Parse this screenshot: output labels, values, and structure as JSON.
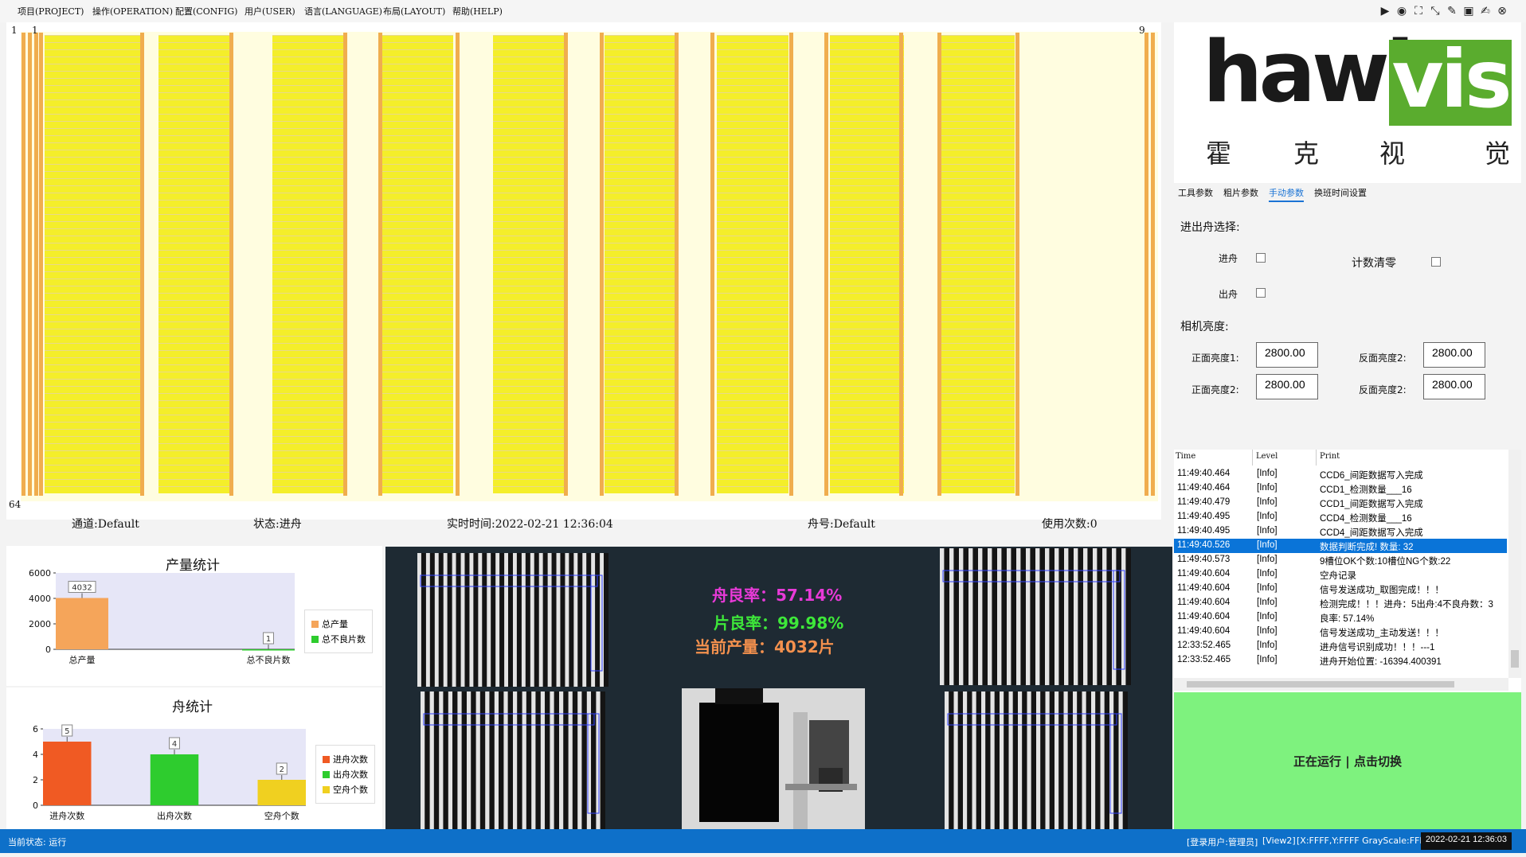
{
  "menu": [
    "项目(PROJECT)",
    "操作(OPERATION)",
    "配置(CONFIG)",
    "用户(USER)",
    "语言(LANGUAGE)",
    "布局(LAYOUT)",
    "帮助(HELP)"
  ],
  "tray": {
    "corner_tl_row": "1",
    "corner_tl_col": "1",
    "corner_tr": "9",
    "corner_bl": "64"
  },
  "info": {
    "channel": "通道:Default",
    "state": "状态:进舟",
    "realtime": "实时时间:2022-02-21 12:36:04",
    "boat": "舟号:Default",
    "uses": "使用次数:0"
  },
  "production_chart": {
    "title": "产量统计",
    "legend": [
      "总产量",
      "总不良片数"
    ],
    "colors": [
      "#f5a55a",
      "#2ecc2e"
    ]
  },
  "boat_chart": {
    "title": "舟统计",
    "legend": [
      "进舟次数",
      "出舟次数",
      "空舟个数"
    ],
    "colors": [
      "#f05a23",
      "#2ecc2e",
      "#f0d020"
    ]
  },
  "chart_data": [
    {
      "type": "bar",
      "title": "产量统计",
      "categories": [
        "总产量",
        "总不良片数"
      ],
      "values": [
        4032,
        1
      ],
      "ylim": [
        0,
        6000
      ],
      "yticks": [
        "0",
        "2000",
        "4000",
        "6000"
      ]
    },
    {
      "type": "bar",
      "title": "舟统计",
      "categories": [
        "进舟次数",
        "出舟次数",
        "空舟个数"
      ],
      "values": [
        5,
        4,
        2
      ],
      "ylim": [
        0,
        6
      ],
      "yticks": [
        "0",
        "2",
        "4",
        "6"
      ]
    }
  ],
  "stats": {
    "boat_yield": "舟良率：57.14%",
    "piece_yield": "片良率：99.98%",
    "current_output": "当前产量：4032片"
  },
  "logo": {
    "brand_left": "hawk",
    "brand_right": "vis",
    "chars": [
      "霍",
      "克",
      "视",
      "觉"
    ]
  },
  "tabs": [
    "工具参数",
    "粗片参数",
    "手动参数",
    "换班时间设置"
  ],
  "active_tab": "手动参数",
  "manual": {
    "boat_select": "进出舟选择:",
    "in_boat": "进舟",
    "out_boat": "出舟",
    "reset_count": "计数清零",
    "camera_brightness": "相机亮度:",
    "front1_label": "正面亮度1:",
    "front1_value": "2800.00",
    "back2a_label": "反面亮度2:",
    "back2a_value": "2800.00",
    "front2_label": "正面亮度2:",
    "front2_value": "2800.00",
    "back2b_label": "反面亮度2:",
    "back2b_value": "2800.00"
  },
  "log": {
    "headers": [
      "Time",
      "Level",
      "Print"
    ],
    "rows": [
      [
        "11:49:40.464",
        "[Info]",
        "CCD6_间距数据写入完成"
      ],
      [
        "11:49:40.464",
        "[Info]",
        "CCD1_检测数量___16"
      ],
      [
        "11:49:40.479",
        "[Info]",
        "CCD1_间距数据写入完成"
      ],
      [
        "11:49:40.495",
        "[Info]",
        "CCD4_检测数量___16"
      ],
      [
        "11:49:40.495",
        "[Info]",
        "CCD4_间距数据写入完成"
      ],
      [
        "11:49:40.526",
        "[Info]",
        "数据判断完成! 数量: 32"
      ],
      [
        "11:49:40.573",
        "[Info]",
        "9槽位OK个数:10槽位NG个数:22"
      ],
      [
        "11:49:40.604",
        "[Info]",
        "空舟记录"
      ],
      [
        "11:49:40.604",
        "[Info]",
        "信号发送成功_取图完成！！！"
      ],
      [
        "11:49:40.604",
        "[Info]",
        "检测完成！！！进舟：5出舟:4不良舟数：3"
      ],
      [
        "11:49:40.604",
        "[Info]",
        "良率:     57.14%"
      ],
      [
        "11:49:40.604",
        "[Info]",
        "信号发送成功_主动发送！！！"
      ],
      [
        "12:33:52.465",
        "[Info]",
        "进舟信号识别成功！！！---1"
      ],
      [
        "12:33:52.465",
        "[Info]",
        "进舟开始位置: -16394.400391"
      ]
    ],
    "selected_index": 5
  },
  "toggle_label": "正在运行 | 点击切换",
  "status": {
    "left": "当前状态: 运行",
    "user": "[登录用户:管理员]",
    "view": "[View2]",
    "pixel": "[X:FFFF,Y:FFFF GrayScale:FFF]",
    "clock": "2022-02-21 12:36:03"
  }
}
